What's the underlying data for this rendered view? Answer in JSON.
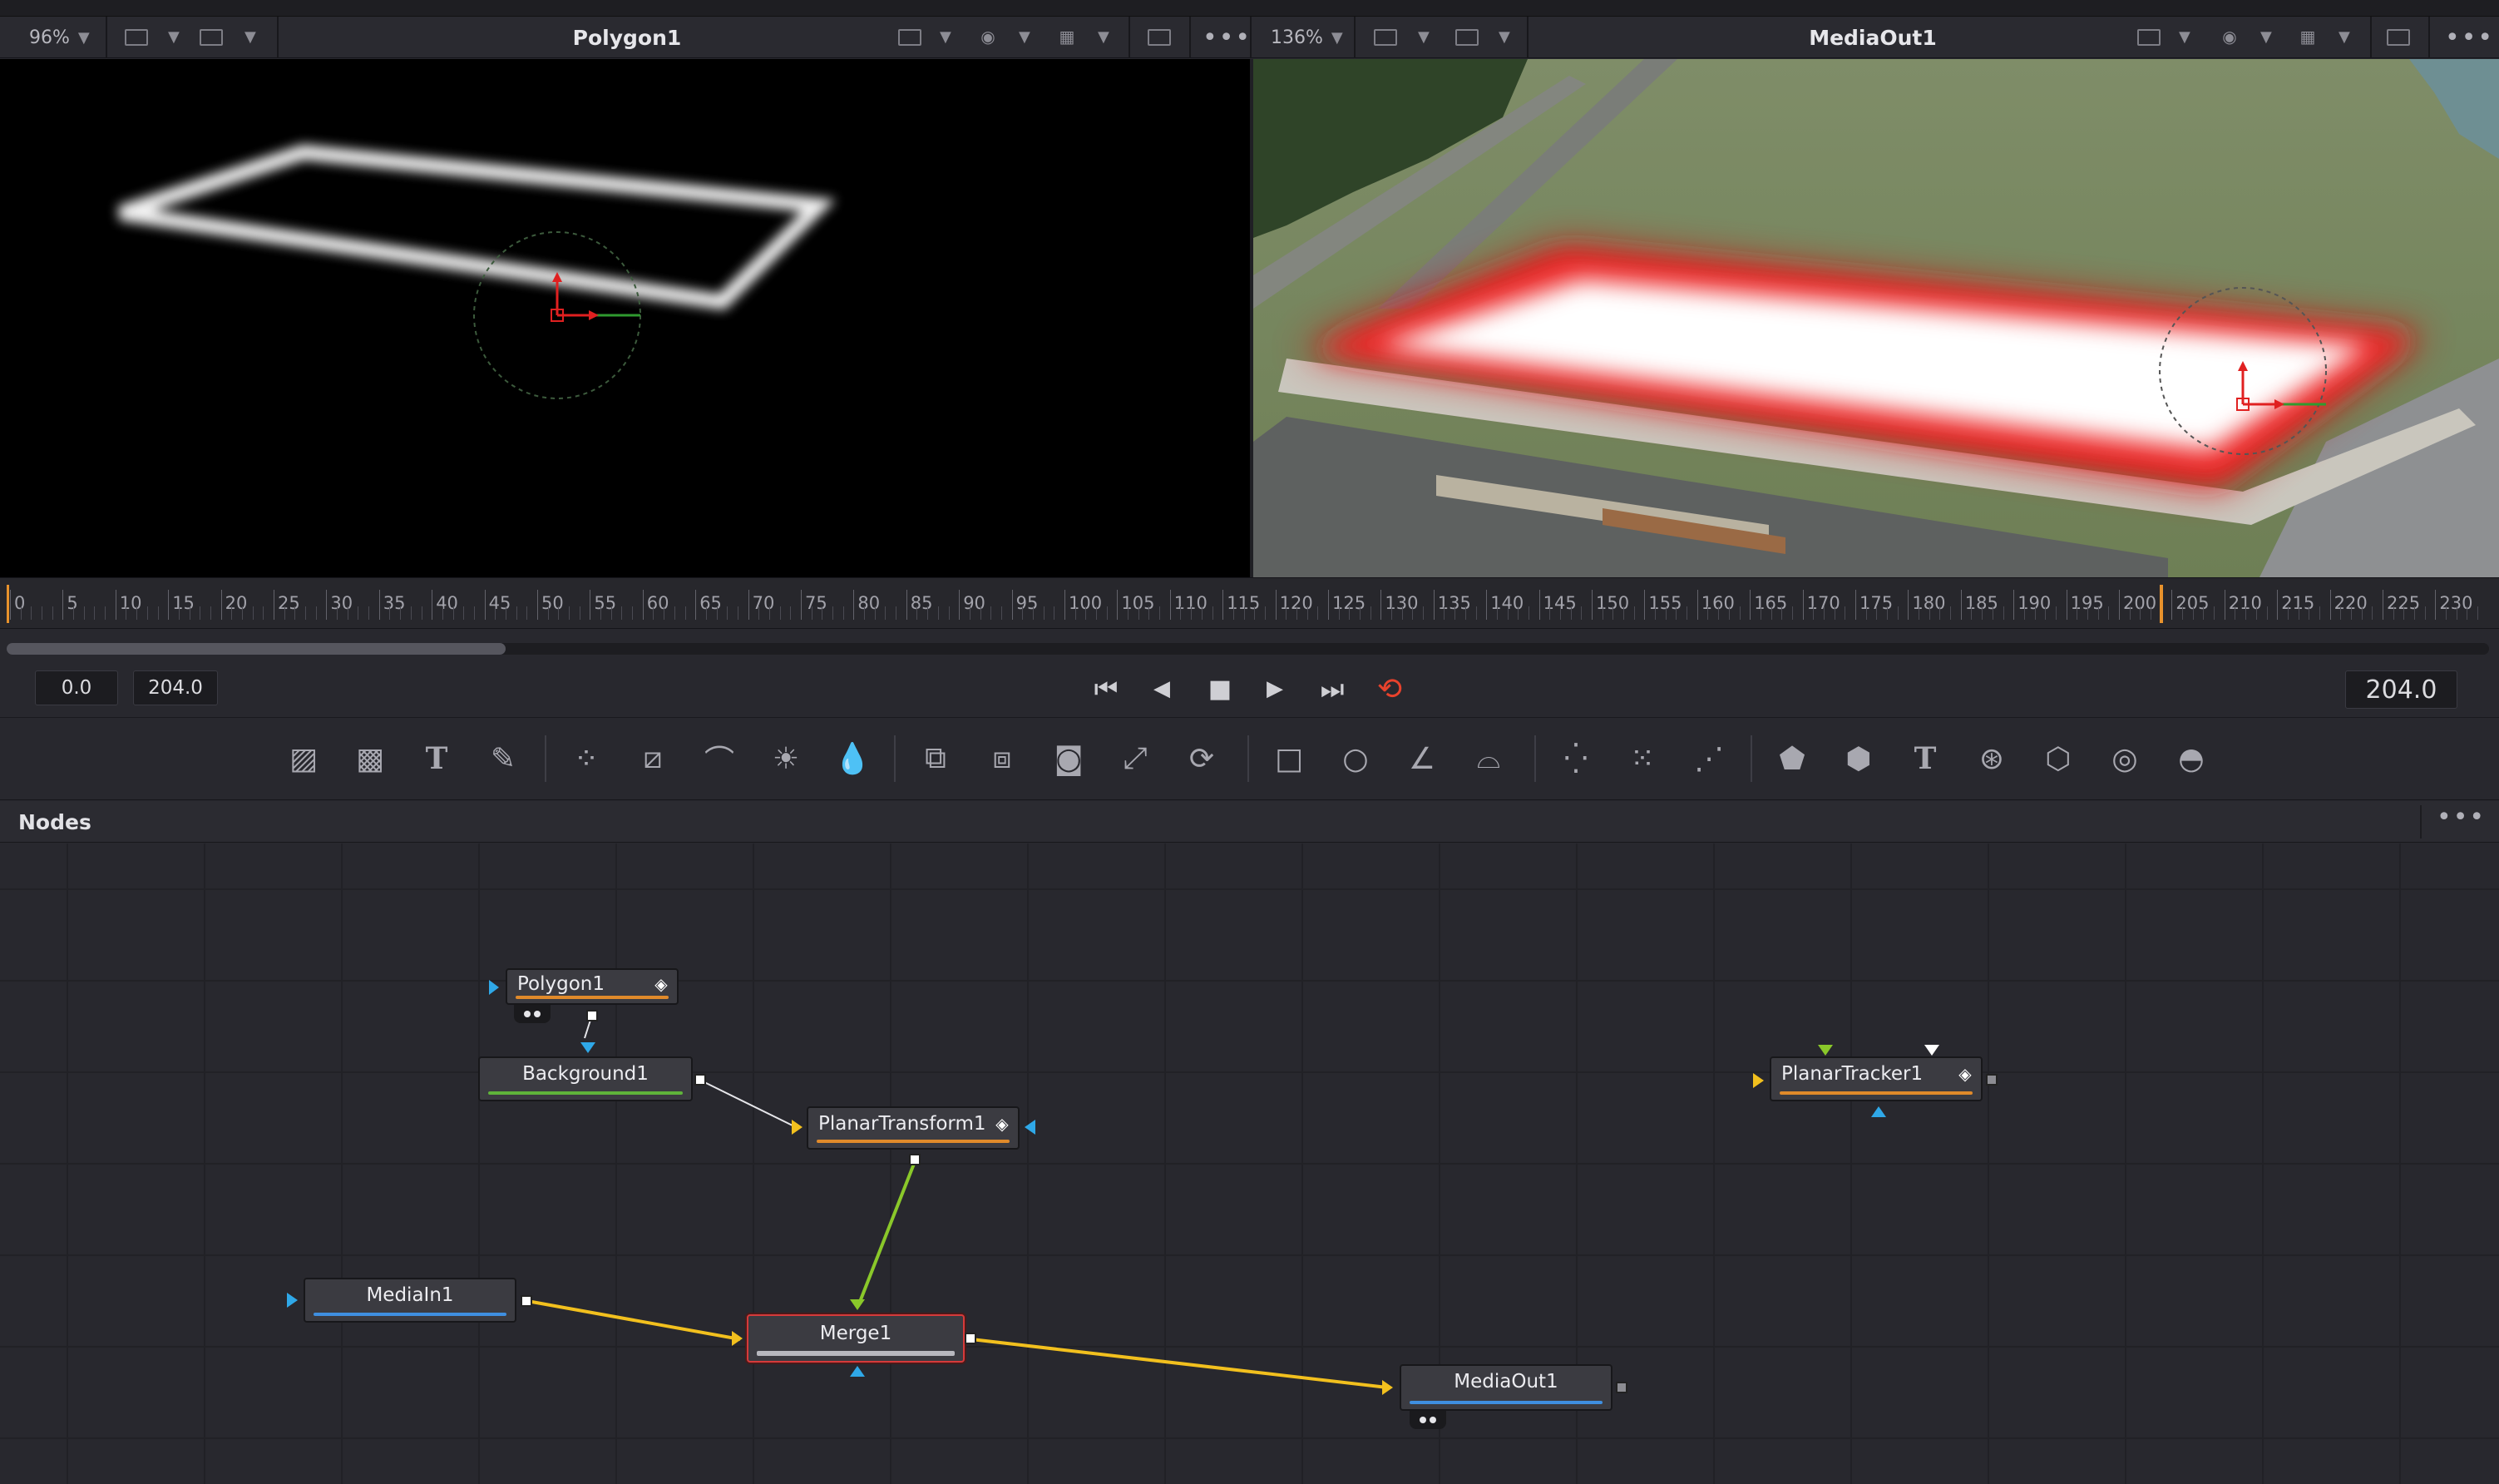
{
  "viewer_left": {
    "zoom": "96%",
    "title": "Polygon1",
    "icons": [
      "single-viewer-icon",
      "layout-icon",
      "roi-icon",
      "color-icon",
      "grid-icon",
      "rect-icon",
      "more-icon"
    ]
  },
  "viewer_right": {
    "zoom": "136%",
    "title": "MediaOut1",
    "icons": [
      "single-viewer-icon",
      "layout-icon",
      "roi-icon",
      "color-icon",
      "grid-icon",
      "rect-icon",
      "more-icon"
    ]
  },
  "timeline": {
    "ticks": [
      "0",
      "5",
      "10",
      "15",
      "20",
      "25",
      "30",
      "35",
      "40",
      "45",
      "50",
      "55",
      "60",
      "65",
      "70",
      "75",
      "80",
      "85",
      "90",
      "95",
      "100",
      "105",
      "110",
      "115",
      "120",
      "125",
      "130",
      "135",
      "140",
      "145",
      "150",
      "155",
      "160",
      "165",
      "170",
      "175",
      "180",
      "185",
      "190",
      "195",
      "200",
      "205",
      "210",
      "215",
      "220",
      "225",
      "230"
    ],
    "render_start": "0.0",
    "render_end": "204.0",
    "current_time": "204.0",
    "playhead_frame": 204
  },
  "transport": {
    "icons": [
      "go-to-start-icon",
      "play-reverse-icon",
      "stop-icon",
      "play-forward-icon",
      "go-to-end-icon",
      "loop-icon"
    ],
    "loop_color": "#e8422c"
  },
  "toolbar": {
    "tools": [
      "background-tool",
      "fast-noise-tool",
      "text-plus-tool",
      "paint-tool",
      "particle-emitter-tool",
      "color-corrector-tool",
      "color-curves-tool",
      "brightness-contrast-tool",
      "blur-tool",
      "merge-tool",
      "channel-booleans-tool",
      "matte-control-tool",
      "transform-tool",
      "resize-tool",
      "rectangle-mask-tool",
      "ellipse-mask-tool",
      "polygon-mask-tool",
      "bspline-mask-tool",
      "particle-render-tool",
      "particle-style-tool",
      "pemitter-tool",
      "shape-3d-tool",
      "merge-3d-tool",
      "text-3d-tool",
      "camera-3d-tool",
      "renderer-3d-tool",
      "spotlight-tool",
      "image-plane-tool"
    ]
  },
  "nodes_panel": {
    "title": "Nodes",
    "nodes": [
      {
        "id": "polygon1",
        "label": "Polygon1",
        "bar_color": "#e08a2a"
      },
      {
        "id": "background1",
        "label": "Background1",
        "bar_color": "#5fb33a"
      },
      {
        "id": "planartransform1",
        "label": "PlanarTransform1",
        "bar_color": "#e08a2a"
      },
      {
        "id": "mediain1",
        "label": "MediaIn1",
        "bar_color": "#3f8fe0"
      },
      {
        "id": "merge1",
        "label": "Merge1",
        "bar_color": "#b8b8be"
      },
      {
        "id": "mediaout1",
        "label": "MediaOut1",
        "bar_color": "#3f8fe0"
      },
      {
        "id": "planartracker1",
        "label": "PlanarTracker1",
        "bar_color": "#e08a2a"
      }
    ],
    "wire_colors": {
      "foreground": "#f2c01e",
      "mask": "#8ac82a",
      "plain": "#e6e6ea"
    },
    "input_colors": {
      "blue": "#2fa8e8",
      "yellow": "#f2c01e",
      "green": "#8ac82a"
    }
  }
}
